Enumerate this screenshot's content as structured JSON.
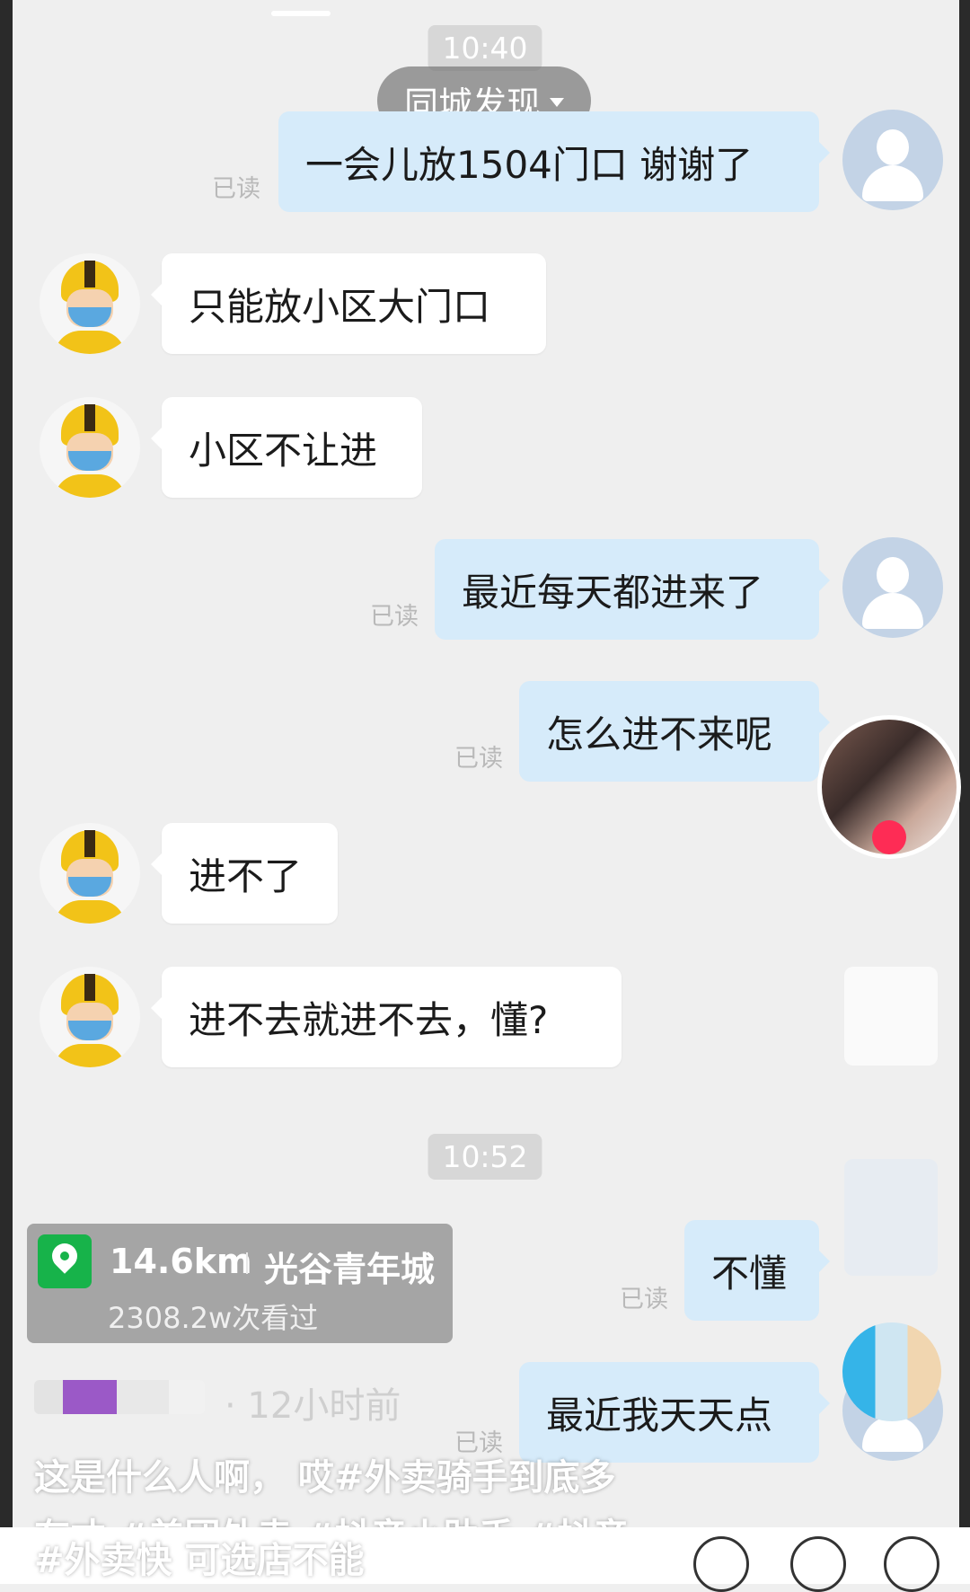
{
  "chat": {
    "time_1": "10:40",
    "time_2": "10:52",
    "read_label": "已读",
    "messages": [
      {
        "text": "一会儿放1504门口 谢谢了",
        "side": "out"
      },
      {
        "text": "只能放小区大门口",
        "side": "in"
      },
      {
        "text": "小区不让进",
        "side": "in"
      },
      {
        "text": "最近每天都进来了",
        "side": "out"
      },
      {
        "text": "怎么进不来呢",
        "side": "out"
      },
      {
        "text": "进不了",
        "side": "in"
      },
      {
        "text": "进不去就进不去，懂?",
        "side": "in"
      },
      {
        "text": "不懂",
        "side": "out"
      },
      {
        "text": "最近我天天点",
        "side": "out"
      }
    ]
  },
  "overlay": {
    "city_tab": "同城发现",
    "location": {
      "distance": "14.6km",
      "place": "光谷青年城",
      "views": "2308.2w次看过"
    },
    "author_time": "· 12小时前",
    "caption_line1": "这是什么人啊，  哎#外卖骑手到底多",
    "caption_line2": "有才 #美团外卖 #抖音小助手 #抖音",
    "caption_line3": "#外卖快 可选店不能"
  },
  "colors": {
    "out_bubble": "#d6ebfa",
    "in_bubble": "#ffffff",
    "location_pin": "#17b34a"
  },
  "icons": [
    "user-avatar-icon",
    "rider-avatar-icon",
    "location-pin-icon",
    "chevron-down-icon"
  ]
}
